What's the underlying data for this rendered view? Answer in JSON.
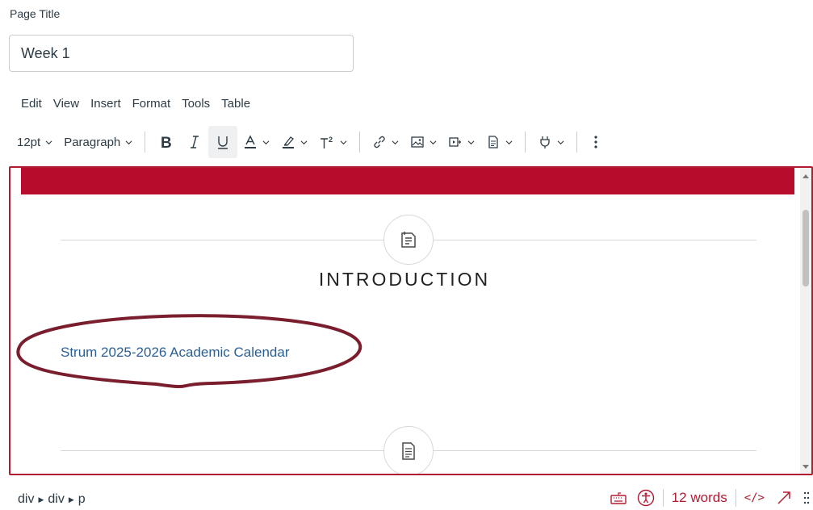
{
  "page_title": {
    "label": "Page Title",
    "value": "Week 1"
  },
  "menubar": {
    "items": [
      "Edit",
      "View",
      "Insert",
      "Format",
      "Tools",
      "Table"
    ]
  },
  "toolbar": {
    "font_size": "12pt",
    "block_format": "Paragraph",
    "bold_icon": "bold-icon",
    "italic_icon": "italic-icon",
    "underline_icon": "underline-icon"
  },
  "content": {
    "heading": "INTRODUCTION",
    "link_text": "Strum 2025-2026 Academic Calendar"
  },
  "statusbar": {
    "path": [
      "div",
      "div",
      "p"
    ],
    "word_count": "12 words",
    "code_view_label": "</>"
  },
  "colors": {
    "brand_red": "#b80c2c",
    "link_blue": "#2b5f93",
    "annotation": "#7a1e2e"
  }
}
